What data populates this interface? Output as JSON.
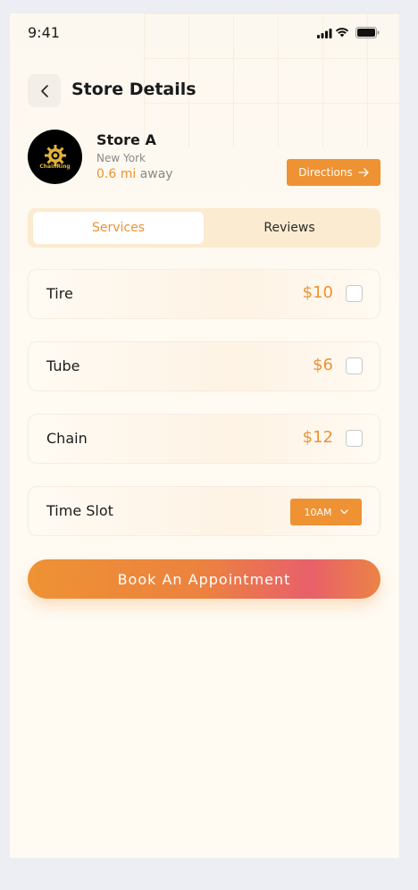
{
  "status_bar": {
    "time": "9:41"
  },
  "header": {
    "title": "Store Details"
  },
  "store": {
    "name": "Store A",
    "city": "New York",
    "distance_value": "0.6 mi",
    "distance_suffix": "away",
    "directions_label": "Directions"
  },
  "tabs": [
    {
      "label": "Services",
      "active": true
    },
    {
      "label": "Reviews",
      "active": false
    }
  ],
  "services": [
    {
      "name": "Tire",
      "price": "$10",
      "checked": false
    },
    {
      "name": "Tube",
      "price": "$6",
      "checked": false
    },
    {
      "name": "Chain",
      "price": "$12",
      "checked": false
    }
  ],
  "time_slot": {
    "label": "Time Slot",
    "selected": "10AM"
  },
  "book_button": {
    "label": "Book An Appointment"
  },
  "colors": {
    "accent": "#ee9233",
    "gradient_end": "#e8606a",
    "tab_bg": "#fbebd0"
  },
  "icons": [
    "back-chevron-icon",
    "signal-icon",
    "wifi-icon",
    "battery-icon",
    "arrow-right-icon",
    "chevron-down-icon",
    "gear-logo-icon"
  ]
}
